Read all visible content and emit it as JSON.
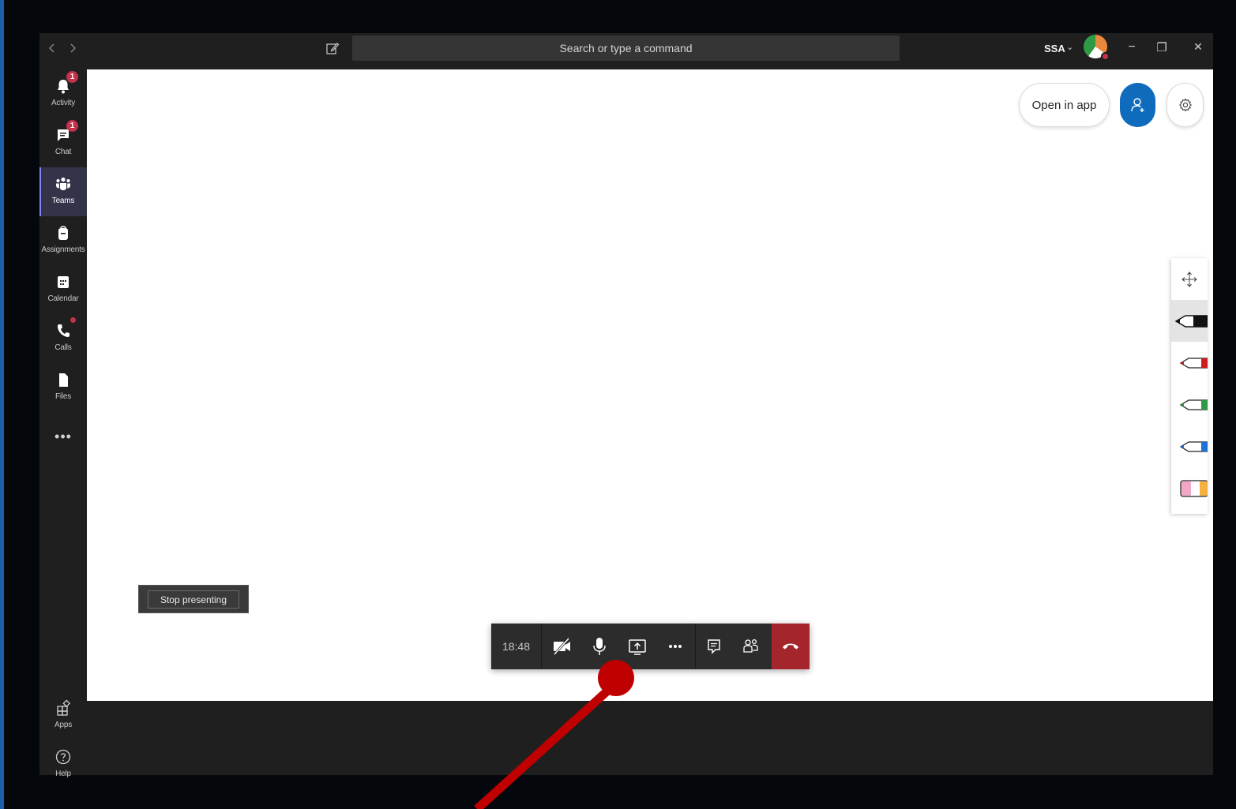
{
  "colors": {
    "accent_blue": "#0f6cbd",
    "badge_red": "#c4314b",
    "hangup_red": "#a4262c",
    "annotation_red": "#c00000",
    "rail_selected": "#33344a"
  },
  "titlebar": {
    "back_icon": "chevron-left-icon",
    "forward_icon": "chevron-right-icon",
    "search_placeholder": "Search or type a command",
    "user_name": "SSA",
    "user_chevron": "⌄",
    "minimize": "−",
    "maximize": "❐",
    "close": "✕"
  },
  "rail": {
    "items": [
      {
        "label": "Activity",
        "icon": "bell-icon",
        "badge": "1"
      },
      {
        "label": "Chat",
        "icon": "chat-icon",
        "badge": "1"
      },
      {
        "label": "Teams",
        "icon": "teams-icon",
        "selected": true
      },
      {
        "label": "Assignments",
        "icon": "backpack-icon"
      },
      {
        "label": "Calendar",
        "icon": "calendar-icon"
      },
      {
        "label": "Calls",
        "icon": "phone-icon",
        "dot": true
      },
      {
        "label": "Files",
        "icon": "file-icon"
      }
    ],
    "more": "•••",
    "bottom_items": [
      {
        "label": "Apps",
        "icon": "apps-icon"
      },
      {
        "label": "Help",
        "icon": "help-icon"
      }
    ]
  },
  "stage": {
    "open_in_app": "Open in app",
    "share_icon": "add-person-icon",
    "settings_icon": "gear-icon"
  },
  "pen_toolbar": {
    "items": [
      "move-icon",
      "black-pen-icon",
      "red-pen-icon",
      "green-pen-icon",
      "blue-pen-icon",
      "eraser-icon"
    ]
  },
  "presenting": {
    "stop_label": "Stop presenting"
  },
  "call_controls": {
    "timer": "18:48",
    "buttons": [
      "camera-off-icon",
      "microphone-icon",
      "share-screen-icon",
      "more-actions-icon",
      "show-conversation-icon",
      "participants-icon",
      "hang-up-icon"
    ]
  }
}
